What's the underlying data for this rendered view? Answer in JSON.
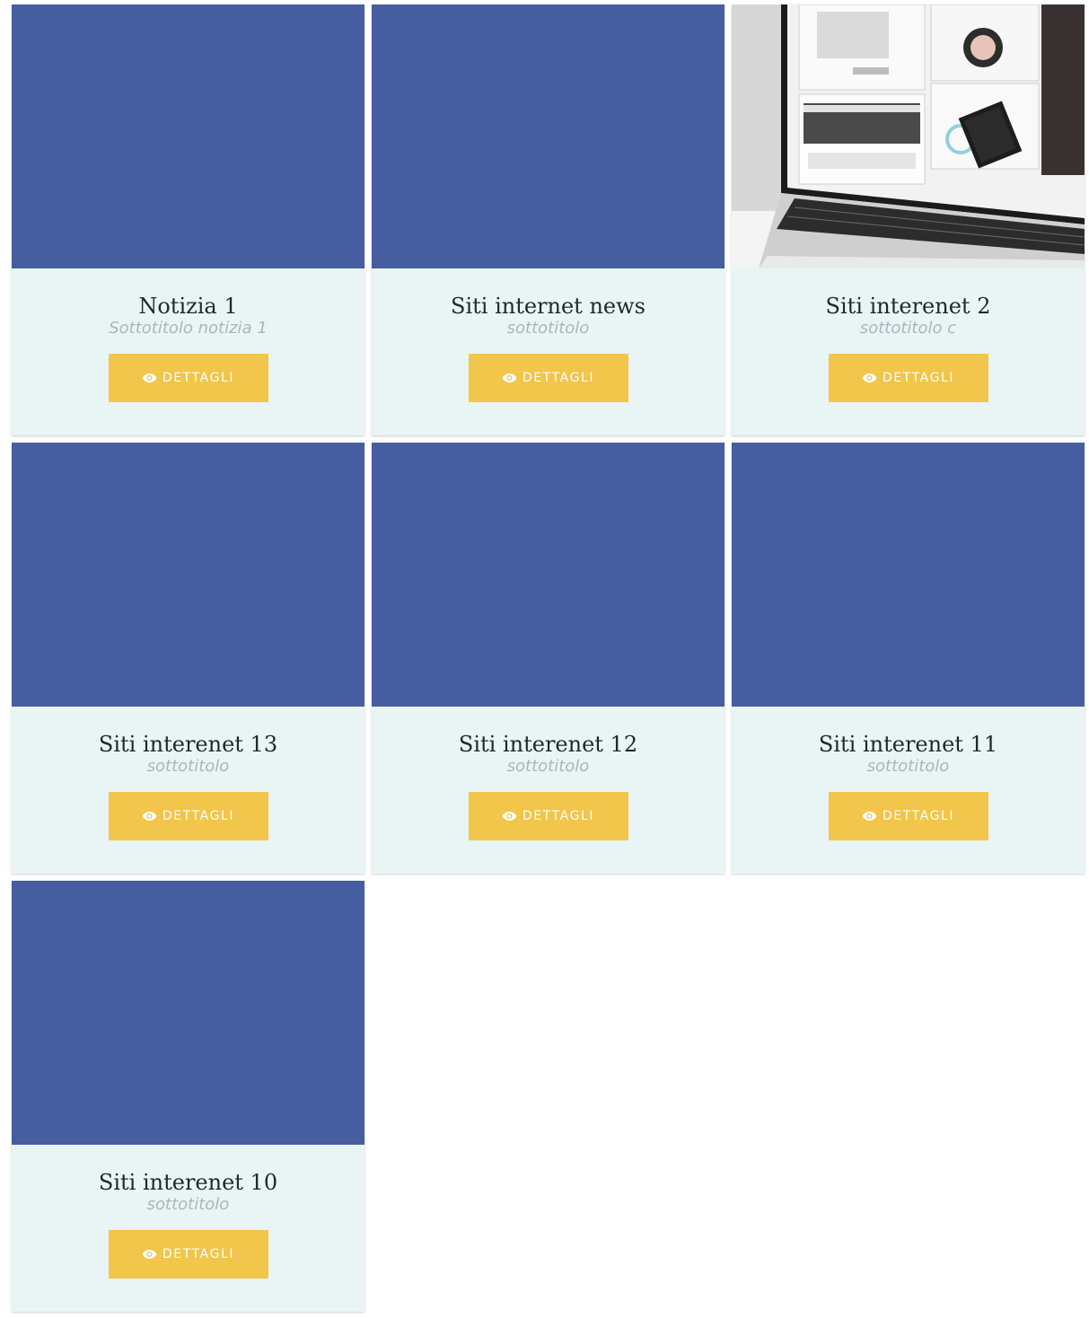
{
  "colors": {
    "placeholder": "#465da0",
    "card_bg": "#e9f5f5",
    "button": "#f2c54b",
    "button_text": "#ffffff",
    "title": "#1a2b2b",
    "subtitle": "#a7b7b7"
  },
  "cards": [
    {
      "title": "Notizia 1",
      "subtitle": "Sottotitolo notizia 1",
      "button": "DETTAGLI",
      "image": "placeholder"
    },
    {
      "title": "Siti internet news",
      "subtitle": "sottotitolo",
      "button": "DETTAGLI",
      "image": "placeholder"
    },
    {
      "title": "Siti interenet 2",
      "subtitle": "sottotitolo c",
      "button": "DETTAGLI",
      "image": "laptop-photo"
    },
    {
      "title": "Siti interenet 13",
      "subtitle": "sottotitolo",
      "button": "DETTAGLI",
      "image": "placeholder"
    },
    {
      "title": "Siti interenet 12",
      "subtitle": "sottotitolo",
      "button": "DETTAGLI",
      "image": "placeholder"
    },
    {
      "title": "Siti interenet 11",
      "subtitle": "sottotitolo",
      "button": "DETTAGLI",
      "image": "placeholder"
    },
    {
      "title": "Siti interenet 10",
      "subtitle": "sottotitolo",
      "button": "DETTAGLI",
      "image": "placeholder"
    }
  ],
  "icons": {
    "button_icon": "eye-icon"
  }
}
